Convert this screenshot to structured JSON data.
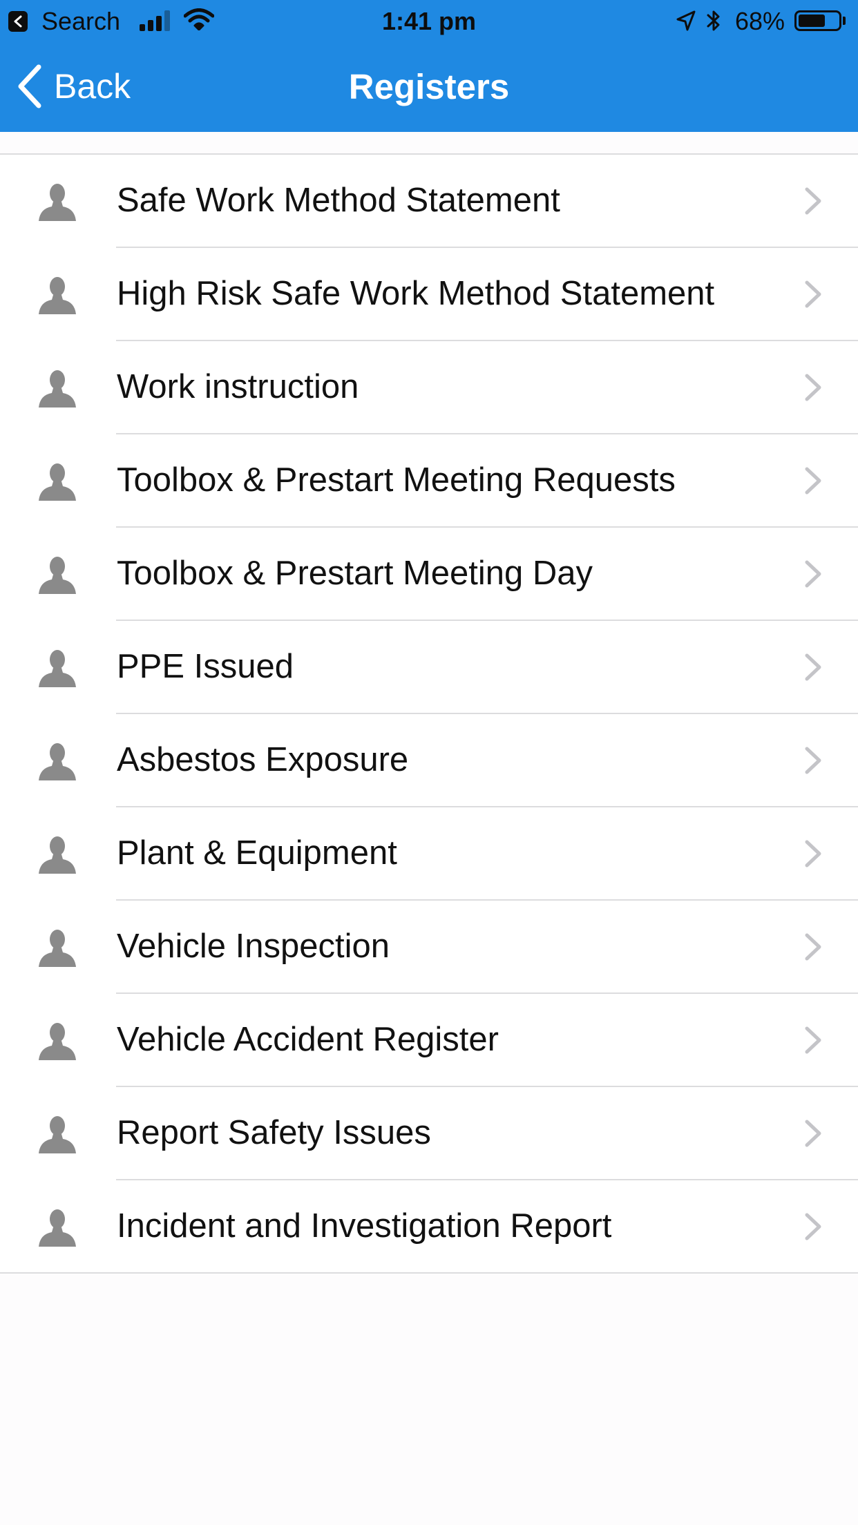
{
  "status_bar": {
    "back_app_label": "Search",
    "time": "1:41 pm",
    "battery_percent": "68%",
    "battery_level": 0.68,
    "signal_bars": 3
  },
  "nav": {
    "back_label": "Back",
    "title": "Registers"
  },
  "colors": {
    "nav_background": "#1f89e2",
    "nav_text": "#ffffff",
    "icon_gray": "#8a8a8a",
    "chevron_gray": "#c4c4c8",
    "separator": "#dcdcde"
  },
  "list": {
    "item_icon": "person-icon",
    "disclosure_icon": "chevron-right-icon",
    "items": [
      {
        "label": "Safe Work Method Statement"
      },
      {
        "label": "High Risk Safe Work Method Statement"
      },
      {
        "label": "Work instruction"
      },
      {
        "label": "Toolbox & Prestart Meeting Requests"
      },
      {
        "label": "Toolbox & Prestart Meeting Day"
      },
      {
        "label": "PPE Issued"
      },
      {
        "label": "Asbestos Exposure"
      },
      {
        "label": "Plant & Equipment"
      },
      {
        "label": "Vehicle Inspection"
      },
      {
        "label": "Vehicle Accident Register"
      },
      {
        "label": "Report Safety Issues"
      },
      {
        "label": "Incident and Investigation Report"
      }
    ]
  }
}
